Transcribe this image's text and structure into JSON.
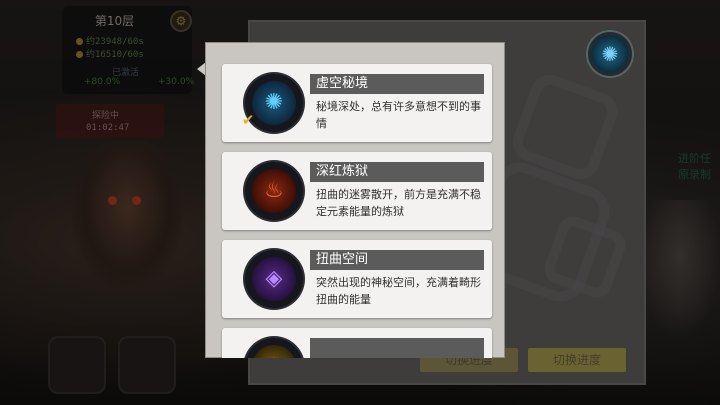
{
  "hud": {
    "floor_title": "第10层",
    "resources": [
      "约23948/60s",
      "约16510/60s"
    ],
    "bonus_label": "已激活",
    "bonus_values": [
      "+80.0%",
      "+30.0%"
    ],
    "explore_label": "探险中",
    "explore_time": "01:02:47"
  },
  "right_side": {
    "lines": [
      "进阶任",
      "原录制"
    ]
  },
  "back_panel": {
    "buttons": [
      "切换进度",
      "切换进度"
    ]
  },
  "worlds": [
    {
      "name": "虚空秘境",
      "description": "秘境深处，总有许多意想不到的事情",
      "icon": "void-lotus-icon",
      "color": "#3fb4e8",
      "selected": true
    },
    {
      "name": "深红炼狱",
      "description": "扭曲的迷雾散开，前方是充满不稳定元素能量的炼狱",
      "icon": "crimson-flame-icon",
      "color": "#e84a1f",
      "selected": false
    },
    {
      "name": "扭曲空间",
      "description": "突然出现的神秘空间，充满着畸形扭曲的能量",
      "icon": "twisted-rune-icon",
      "color": "#8a4ad8",
      "selected": false
    },
    {
      "name": "",
      "description": "",
      "icon": "golden-world-icon",
      "color": "#d8b23a",
      "selected": false
    }
  ]
}
